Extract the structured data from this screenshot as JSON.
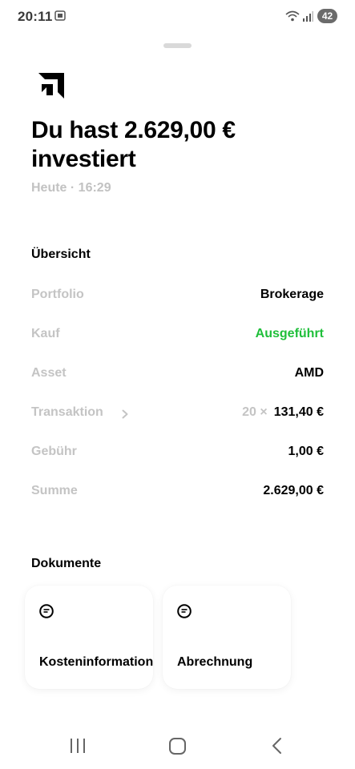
{
  "status_bar": {
    "time": "20:11",
    "battery": "42"
  },
  "header": {
    "headline_line1": "Du hast 2.629,00 €",
    "headline_line2": "investiert",
    "timestamp": "Heute · 16:29"
  },
  "overview": {
    "title": "Übersicht",
    "rows": [
      {
        "label": "Portfolio",
        "value": "Brokerage"
      },
      {
        "label": "Kauf",
        "value": "Ausgeführt"
      },
      {
        "label": "Asset",
        "value": "AMD"
      },
      {
        "label": "Transaktion",
        "quantity": "20 ×",
        "value": "131,40 €"
      },
      {
        "label": "Gebühr",
        "value": "1,00 €"
      },
      {
        "label": "Summe",
        "value": "2.629,00 €"
      }
    ]
  },
  "documents": {
    "title": "Dokumente",
    "items": [
      {
        "label": "Kosteninformation",
        "icon": "document-icon"
      },
      {
        "label": "Abrechnung",
        "icon": "document-icon"
      }
    ]
  },
  "colors": {
    "success": "#1fbf3a",
    "muted": "#c4c4c4"
  }
}
